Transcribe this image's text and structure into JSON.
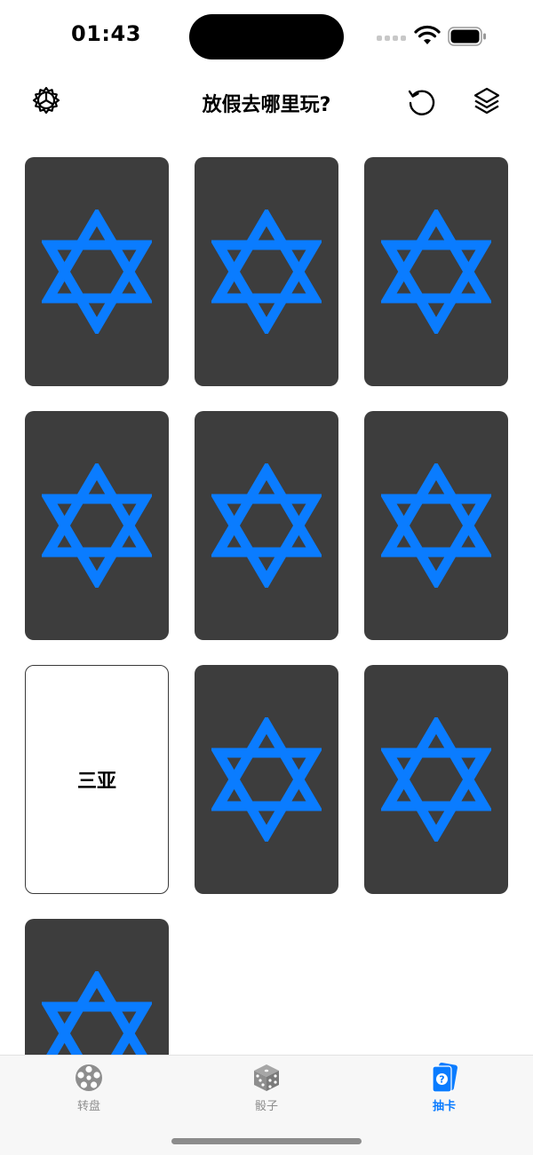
{
  "status_bar": {
    "time": "01:43"
  },
  "nav": {
    "title": "放假去哪里玩?"
  },
  "cards": [
    {
      "revealed": false,
      "label": ""
    },
    {
      "revealed": false,
      "label": ""
    },
    {
      "revealed": false,
      "label": ""
    },
    {
      "revealed": false,
      "label": ""
    },
    {
      "revealed": false,
      "label": ""
    },
    {
      "revealed": false,
      "label": ""
    },
    {
      "revealed": true,
      "label": "三亚"
    },
    {
      "revealed": false,
      "label": ""
    },
    {
      "revealed": false,
      "label": ""
    },
    {
      "revealed": false,
      "label": ""
    }
  ],
  "tabs": [
    {
      "label": "转盘",
      "icon": "wheel-icon",
      "active": false
    },
    {
      "label": "骰子",
      "icon": "dice-icon",
      "active": false
    },
    {
      "label": "抽卡",
      "icon": "card-draw-icon",
      "active": true
    }
  ],
  "colors": {
    "accent": "#0a7cff",
    "card_back": "#3d3d3d",
    "inactive_tab": "#8e8e8e"
  }
}
